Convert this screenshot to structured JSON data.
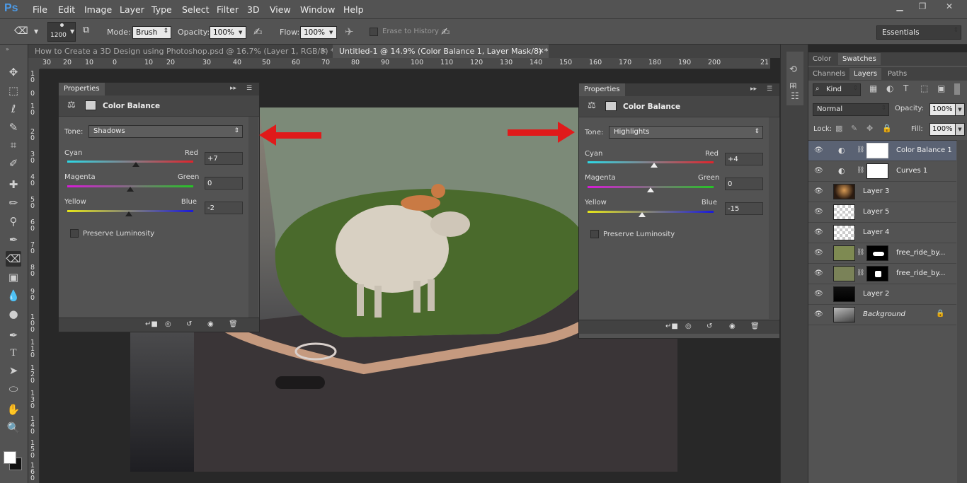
{
  "app": {
    "logo": "Ps"
  },
  "menu": [
    "File",
    "Edit",
    "Image",
    "Layer",
    "Type",
    "Select",
    "Filter",
    "3D",
    "View",
    "Window",
    "Help"
  ],
  "options": {
    "brush_size": "1200",
    "mode_label": "Mode:",
    "mode_value": "Brush",
    "opacity_label": "Opacity:",
    "opacity_value": "100%",
    "flow_label": "Flow:",
    "flow_value": "100%",
    "erase_history": "Erase to History",
    "workspace": "Essentials"
  },
  "tabs": [
    {
      "label": "How to Create a 3D Design using Photoshop.psd @ 16.7% (Layer 1, RGB/8) *",
      "close": "×"
    },
    {
      "label": "Untitled-1 @ 14.9% (Color Balance 1, Layer Mask/8) *",
      "close": "×"
    }
  ],
  "ruler_h": [
    "30",
    "20",
    "10",
    "0",
    "10",
    "20",
    "30",
    "40",
    "50",
    "60",
    "70",
    "80",
    "90",
    "100",
    "110",
    "120",
    "130",
    "140",
    "150",
    "160",
    "170",
    "180",
    "190",
    "200",
    "21"
  ],
  "ruler_v": [
    "10",
    "0",
    "10",
    "20",
    "30",
    "40",
    "50",
    "60",
    "70",
    "80",
    "90",
    "100",
    "110",
    "120",
    "130",
    "140",
    "150",
    "160"
  ],
  "panel_left": {
    "tab": "Properties",
    "title": "Color Balance",
    "tone_label": "Tone:",
    "tone_value": "Shadows",
    "sliders": [
      {
        "left": "Cyan",
        "right": "Red",
        "value": "+7",
        "pos": 0.555
      },
      {
        "left": "Magenta",
        "right": "Green",
        "value": "0",
        "pos": 0.5
      },
      {
        "left": "Yellow",
        "right": "Blue",
        "value": "-2",
        "pos": 0.485
      }
    ],
    "preserve": "Preserve Luminosity"
  },
  "panel_right": {
    "tab": "Properties",
    "title": "Color Balance",
    "tone_label": "Tone:",
    "tone_value": "Highlights",
    "sliders": [
      {
        "left": "Cyan",
        "right": "Red",
        "value": "+4",
        "pos": 0.53
      },
      {
        "left": "Magenta",
        "right": "Green",
        "value": "0",
        "pos": 0.5
      },
      {
        "left": "Yellow",
        "right": "Blue",
        "value": "-15",
        "pos": 0.42
      }
    ],
    "preserve": "Preserve Luminosity"
  },
  "rpanel": {
    "tabs_top": [
      "Color",
      "Swatches"
    ],
    "tabs_layers": [
      "Channels",
      "Layers",
      "Paths"
    ],
    "filter_kind": "Kind",
    "blend_mode": "Normal",
    "opacity_label": "Opacity:",
    "opacity_value": "100%",
    "lock_label": "Lock:",
    "fill_label": "Fill:",
    "fill_value": "100%",
    "layers": [
      {
        "name": "Color Balance 1",
        "selected": true
      },
      {
        "name": "Curves 1",
        "selected": false
      },
      {
        "name": "Layer 3",
        "selected": false
      },
      {
        "name": "Layer 5",
        "selected": false
      },
      {
        "name": "Layer 4",
        "selected": false
      },
      {
        "name": "free_ride_by...",
        "selected": false
      },
      {
        "name": "free_ride_by...",
        "selected": false
      },
      {
        "name": "Layer 2",
        "selected": false
      },
      {
        "name": "Background",
        "selected": false
      }
    ]
  },
  "colors": {
    "accent_red": "#e01a1a",
    "ps_blue": "#4c9be8",
    "selected_layer": "#5a6273"
  }
}
